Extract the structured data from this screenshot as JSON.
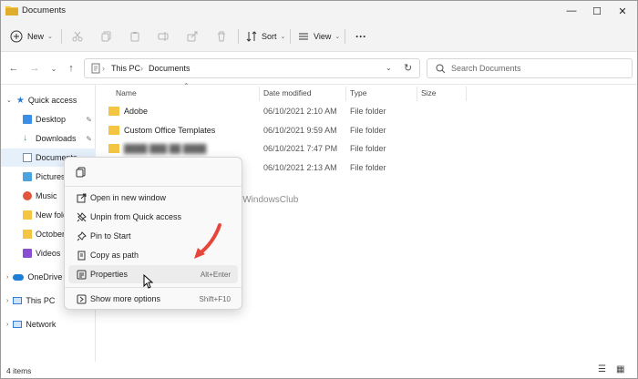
{
  "window": {
    "title": "Documents",
    "minimize": "—",
    "maximize": "☐",
    "close": "✕"
  },
  "toolbar": {
    "new_label": "New",
    "sort_label": "Sort",
    "view_label": "View",
    "more_label": "···"
  },
  "address": {
    "root": "This PC",
    "current": "Documents",
    "separator": "›",
    "search_placeholder": "Search Documents"
  },
  "sidebar": {
    "items": [
      {
        "label": "Quick access"
      },
      {
        "label": "Desktop"
      },
      {
        "label": "Downloads"
      },
      {
        "label": "Documents"
      },
      {
        "label": "Pictures"
      },
      {
        "label": "Music"
      },
      {
        "label": "New fold"
      },
      {
        "label": "October"
      },
      {
        "label": "Videos"
      },
      {
        "label": "OneDrive"
      },
      {
        "label": "This PC"
      },
      {
        "label": "Network"
      }
    ]
  },
  "columns": {
    "name": "Name",
    "date": "Date modified",
    "type": "Type",
    "size": "Size"
  },
  "files": [
    {
      "name": "Adobe",
      "date": "06/10/2021 2:10 AM",
      "type": "File folder"
    },
    {
      "name": "Custom Office Templates",
      "date": "06/10/2021 9:59 AM",
      "type": "File folder"
    },
    {
      "name": "",
      "date": "06/10/2021 7:47 PM",
      "type": "File folder"
    },
    {
      "name": "",
      "date": "06/10/2021 2:13 AM",
      "type": "File folder"
    }
  ],
  "status": {
    "count": "4 items"
  },
  "context_menu": {
    "items": [
      {
        "label": "Open in new window",
        "shortcut": ""
      },
      {
        "label": "Unpin from Quick access",
        "shortcut": ""
      },
      {
        "label": "Pin to Start",
        "shortcut": ""
      },
      {
        "label": "Copy as path",
        "shortcut": ""
      },
      {
        "label": "Properties",
        "shortcut": "Alt+Enter"
      },
      {
        "label": "Show more options",
        "shortcut": "Shift+F10"
      }
    ]
  },
  "watermark": "TheWindowsClub",
  "colors": {
    "accent": "#0067c0",
    "folder": "#f4c542",
    "arrow": "#e8463a",
    "selection": "#e5f0fb"
  }
}
